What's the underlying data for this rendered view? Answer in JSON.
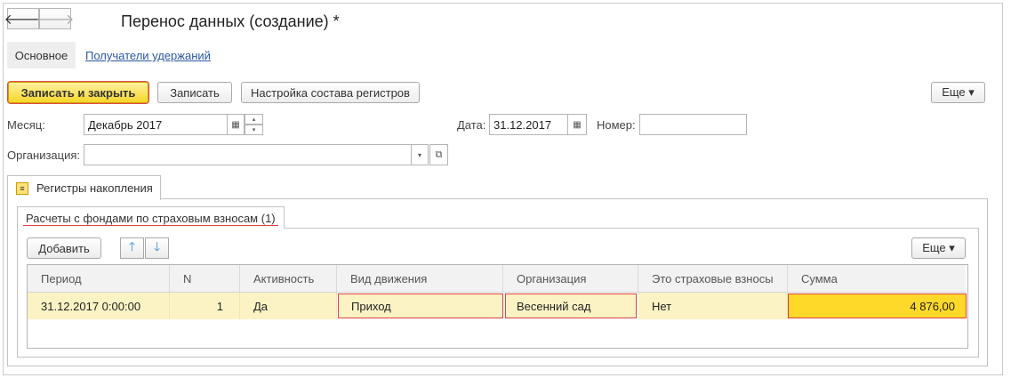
{
  "window": {
    "title": "Перенос данных (создание) *"
  },
  "nav": {
    "back": "🡐",
    "forward": "🡒"
  },
  "tabs": {
    "main": "Основное",
    "recipients": "Получатели удержаний"
  },
  "toolbar": {
    "save_close": "Записать и закрыть",
    "save": "Записать",
    "settings": "Настройка состава регистров",
    "more": "Еще ▾"
  },
  "form": {
    "month_label": "Месяц:",
    "month_value": "Декабрь 2017",
    "date_label": "Дата:",
    "date_value": "31.12.2017",
    "number_label": "Номер:",
    "number_value": "",
    "org_label": "Организация:",
    "org_value": ""
  },
  "registers": {
    "tab_label": "Регистры накопления",
    "subtab_label": "Расчеты с фондами по страховым взносам (1)",
    "add_button": "Добавить",
    "more": "Еще ▾",
    "columns": [
      "Период",
      "N",
      "Активность",
      "Вид движения",
      "Организация",
      "Это страховые взносы",
      "Сумма"
    ],
    "rows": [
      [
        "31.12.2017 0:00:00",
        "1",
        "Да",
        "Приход",
        "Весенний сад",
        "Нет",
        "4 876,00"
      ]
    ]
  }
}
